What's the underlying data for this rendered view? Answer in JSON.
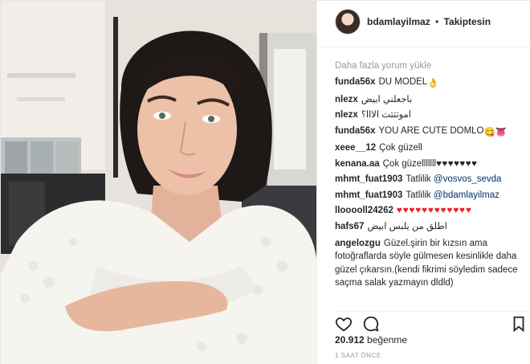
{
  "post": {
    "username": "bdamlayilmaz",
    "separator": "•",
    "follow_status": "Takiptesin"
  },
  "comments": {
    "load_more": "Daha fazla yorum yükle",
    "items": [
      {
        "user": "funda56x",
        "text": "DU MODEL",
        "emoji": "👌"
      },
      {
        "user": "nlezx",
        "text": "باجعلني ابيض"
      },
      {
        "user": "nlezx",
        "text": "اموتتتت الااا؟"
      },
      {
        "user": "funda56x",
        "text": "YOU ARE CUTE DOMLO",
        "emoji": "😋👅"
      },
      {
        "user": "xeee__12",
        "text": "Çok güzell"
      },
      {
        "user": "kenana.aa",
        "text": "Çok güzelllllll",
        "extra": "♥♥♥♥♥♥♥"
      },
      {
        "user": "mhmt_fuat1903",
        "text": "Tatlilik",
        "mention": "@vosvos_sevda"
      },
      {
        "user": "mhmt_fuat1903",
        "text": "Tatlilik",
        "mention": "@bdamlayilmaz"
      },
      {
        "user": "llooooll24262",
        "hearts": "♥♥♥♥♥♥♥♥♥♥♥♥"
      },
      {
        "user": "hafs67",
        "text": "اطلق من يلبس ابيض"
      },
      {
        "user": "angelozgu",
        "text": "Güzel.şirin bir kızsın ama fotoğraflarda söyle gülmesen kesinlikle daha güzel çıkarsın.(kendi fikrimi söyledim sadece saçma salak yazmayın dldld)"
      }
    ]
  },
  "actions": {
    "like_icon": "heart-outline-icon",
    "comment_icon": "comment-bubble-icon",
    "save_icon": "bookmark-icon"
  },
  "likes": {
    "count": "20.912",
    "label": "beğenme"
  },
  "timestamp": "1 SAAT ÖNCE",
  "colors": {
    "mention": "#003569",
    "heart": "#ed1c24",
    "muted": "#999999",
    "text": "#262626"
  }
}
